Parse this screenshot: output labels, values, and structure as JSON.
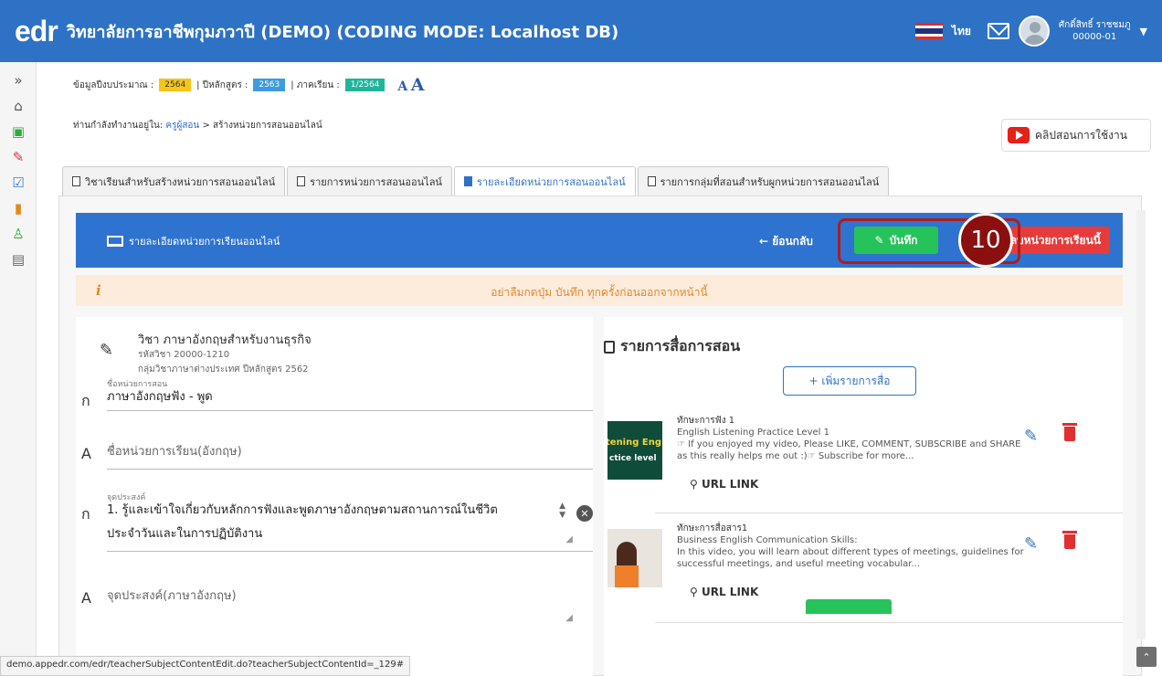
{
  "app": {
    "logo": "edr",
    "title": "วิทยาลัยการอาชีพกุมภวาปี (DEMO) (CODING MODE: Localhost DB)",
    "language": "ไทย",
    "user_name": "ศักดิ์สิทธิ์ ราชชมภู",
    "user_id": "00000-01"
  },
  "info": {
    "budget_label": "ข้อมูลปีงบประมาณ :",
    "budget_year": "2564",
    "curriculum_label": "| ปีหลักสูตร :",
    "curriculum_year": "2563",
    "semester_label": "| ภาคเรียน :",
    "semester": "1/2564",
    "font_small": "A",
    "font_large": "A"
  },
  "breadcrumb": {
    "prefix": "ท่านกำลังทำงานอยู่ใน:",
    "link": "ครูผู้สอน",
    "current": " > สร้างหน่วยการสอนออนไลน์"
  },
  "help_button": "คลิปสอนการใช้งาน",
  "tabs": [
    {
      "label": "วิชาเรียนสำหรับสร้างหน่วยการสอนออนไลน์"
    },
    {
      "label": "รายการหน่วยการสอนออนไลน์"
    },
    {
      "label": "รายละเอียดหน่วยการสอนออนไลน์"
    },
    {
      "label": "รายการกลุ่มที่สอนสำหรับผูกหน่วยการสอนออนไลน์"
    }
  ],
  "panel": {
    "title": "รายละเอียดหน่วยการเรียนออนไลน์",
    "back": "← ย้อนกลับ",
    "save": "บันทึก",
    "delete": "ลบหน่วยการเรียนนี้",
    "step": "10",
    "warning": "อย่าลืมกดปุ่ม บันทึก ทุกครั้งก่อนออกจากหน้านี้"
  },
  "subject": {
    "title": "วิชา ภาษาอังกฤษสำหรับงานธุรกิจ",
    "code": "รหัสวิชา 20000-1210",
    "group": "กลุ่มวิชาภาษาต่างประเทศ ปีหลักสูตร 2562"
  },
  "form": {
    "unit_name_label": "ชื่อหน่วยการสอน",
    "unit_name": "ภาษาอังกฤษฟัง - พูด",
    "unit_name_en_placeholder": "ชื่อหน่วยการเรียน(อังกฤษ)",
    "objective_label": "จุดประสงค์",
    "objective_line1": "1. รู้และเข้าใจเกี่ยวกับหลักการฟังและพูดภาษาอังกฤษตามสถานการณ์ในชีวิต",
    "objective_line2": "ประจำวันและในการปฏิบัติงาน",
    "objective_en_placeholder": "จุดประสงค์(ภาษาอังกฤษ)"
  },
  "media": {
    "title": "รายการสื่อการสอน",
    "add_button": "+ เพิ่มรายการสื่อ",
    "items": [
      {
        "title": "ทักษะการฟัง 1",
        "desc": "English Listening Practice Level 1",
        "desc2": "☞ If you enjoyed my video, Please LIKE, COMMENT, SUBSCRIBE and SHARE as this really helps me out :)☞ Subscribe for more...",
        "url": "URL LINK",
        "thumb_text": "tening Eng",
        "thumb_text2": "ctice level"
      },
      {
        "title": "ทักษะการสื่อสาร1",
        "desc": "Business English Communication Skills:",
        "desc2": "In this video, you will learn about different types of meetings, guidelines for successful meetings, and useful meeting vocabular...",
        "url": "URL LINK"
      }
    ]
  },
  "statusbar": "demo.appedr.com/edr/teacherSubjectContentEdit.do?teacherSubjectContentId=_129#"
}
